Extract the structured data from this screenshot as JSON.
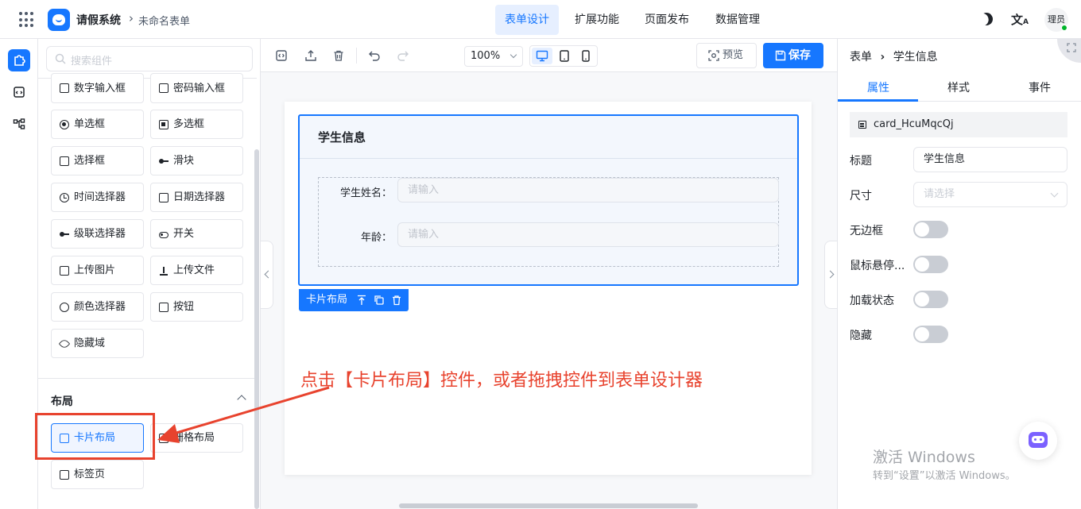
{
  "header": {
    "app_title": "请假系统",
    "form_name": "未命名表单",
    "nav_tabs": [
      {
        "label": "表单设计",
        "active": true
      },
      {
        "label": "扩展功能",
        "active": false
      },
      {
        "label": "页面发布",
        "active": false
      },
      {
        "label": "数据管理",
        "active": false
      }
    ],
    "user_name": "理员"
  },
  "components": {
    "search_placeholder": "搜索组件",
    "items": [
      {
        "label": "数字输入框",
        "icon": "number-input-icon"
      },
      {
        "label": "密码输入框",
        "icon": "lock-icon"
      },
      {
        "label": "单选框",
        "icon": "radio-icon"
      },
      {
        "label": "多选框",
        "icon": "checkbox-icon"
      },
      {
        "label": "选择框",
        "icon": "select-icon"
      },
      {
        "label": "滑块",
        "icon": "slider-icon"
      },
      {
        "label": "时间选择器",
        "icon": "clock-icon"
      },
      {
        "label": "日期选择器",
        "icon": "calendar-icon"
      },
      {
        "label": "级联选择器",
        "icon": "cascader-icon"
      },
      {
        "label": "开关",
        "icon": "toggle-icon"
      },
      {
        "label": "上传图片",
        "icon": "image-icon"
      },
      {
        "label": "上传文件",
        "icon": "upload-icon"
      },
      {
        "label": "颜色选择器",
        "icon": "palette-icon"
      },
      {
        "label": "按钮",
        "icon": "button-icon"
      },
      {
        "label": "隐藏域",
        "icon": "eye-off-icon"
      }
    ],
    "layout_section_title": "布局",
    "layout_items": [
      {
        "label": "卡片布局",
        "icon": "card-icon",
        "selected": true
      },
      {
        "label": "栅格布局",
        "icon": "grid-icon",
        "selected": false
      },
      {
        "label": "标签页",
        "icon": "tabs-icon",
        "selected": false
      }
    ]
  },
  "toolbar": {
    "zoom": "100%",
    "preview_label": "预览",
    "save_label": "保存"
  },
  "canvas": {
    "card_title": "学生信息",
    "fields": [
      {
        "label": "学生姓名：",
        "placeholder": "请输入"
      },
      {
        "label": "年龄：",
        "placeholder": "请输入"
      }
    ],
    "card_tag_label": "卡片布局",
    "annotation": "点击【卡片布局】控件，或者拖拽控件到表单设计器"
  },
  "properties": {
    "breadcrumb_root": "表单",
    "breadcrumb_current": "学生信息",
    "tabs": [
      {
        "label": "属性",
        "active": true
      },
      {
        "label": "样式",
        "active": false
      },
      {
        "label": "事件",
        "active": false
      }
    ],
    "component_id": "card_HcuMqcQj",
    "title_label": "标题",
    "title_value": "学生信息",
    "size_label": "尺寸",
    "size_placeholder": "请选择",
    "switches": [
      {
        "label": "无边框",
        "on": false
      },
      {
        "label": "鼠标悬停...",
        "on": false
      },
      {
        "label": "加载状态",
        "on": false
      },
      {
        "label": "隐藏",
        "on": false
      }
    ]
  },
  "watermark": {
    "line1": "激活 Windows",
    "line2": "转到“设置”以激活 Windows。"
  },
  "colors": {
    "accent": "#1677ff",
    "annotation_red": "#e8432e"
  }
}
